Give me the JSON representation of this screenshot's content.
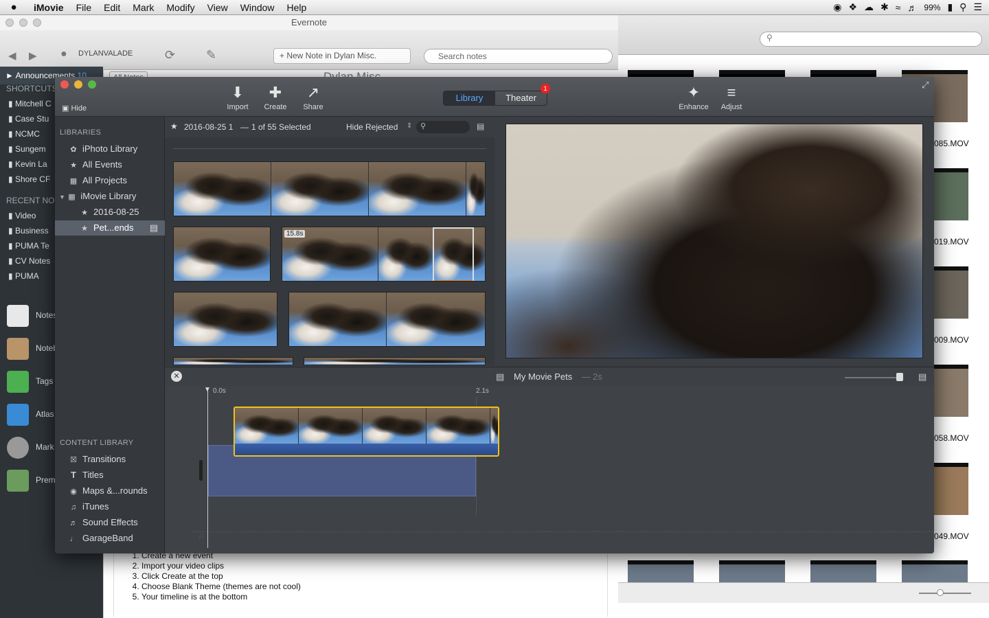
{
  "menubar": {
    "app": "iMovie",
    "items": [
      "File",
      "Edit",
      "Mark",
      "Modify",
      "View",
      "Window",
      "Help"
    ],
    "battery": "99%"
  },
  "evernote": {
    "title": "Evernote",
    "user": "DYLANVALADE",
    "new_note": "New Note in Dylan Misc.",
    "search_placeholder": "Search notes",
    "announcements": "Announcements",
    "announcements_count": "10",
    "shortcuts_header": "SHORTCUTS",
    "shortcuts": [
      "Mitchell C",
      "Case Stu",
      "NCMC",
      "Sungem",
      "Kevin La",
      "Shore CF"
    ],
    "recent_header": "RECENT NO",
    "recent": [
      "Video",
      "Business",
      "PUMA Te",
      "CV Notes",
      "PUMA"
    ],
    "nav": [
      "Notes",
      "Noteb",
      "Tags",
      "Atlas",
      "Mark",
      "Prem"
    ],
    "all_notes": "All Notes",
    "notebook_title": "Dylan Misc.",
    "note_steps": [
      "Create a new event",
      "Import your video clips",
      "Click Create at the top",
      "Choose Blank Theme (themes are not cool)",
      "Your timeline is at the bottom"
    ]
  },
  "finder": {
    "files": [
      "085.MOV",
      "019.MOV",
      "009.MOV",
      "058.MOV",
      "049.MOV"
    ]
  },
  "imovie": {
    "hide": "Hide",
    "toolbar": {
      "import": "Import",
      "create": "Create",
      "share": "Share",
      "enhance": "Enhance",
      "adjust": "Adjust"
    },
    "tabs": {
      "library": "Library",
      "theater": "Theater",
      "theater_badge": "1"
    },
    "libraries_header": "LIBRARIES",
    "libraries": [
      "iPhoto Library",
      "All Events",
      "All Projects",
      "iMovie Library",
      "2016-08-25",
      "Pet...ends"
    ],
    "content_header": "CONTENT LIBRARY",
    "content": [
      "Transitions",
      "Titles",
      "Maps &...rounds",
      "iTunes",
      "Sound Effects",
      "GarageBand"
    ],
    "browser": {
      "event": "2016-08-25 1",
      "selection": "1 of 55 Selected",
      "filter": "Hide Rejected",
      "clip_duration": "15.8s"
    },
    "timeline": {
      "project": "My Movie Pets",
      "duration": "2s",
      "start": "0.0s",
      "end": "2.1s"
    }
  }
}
